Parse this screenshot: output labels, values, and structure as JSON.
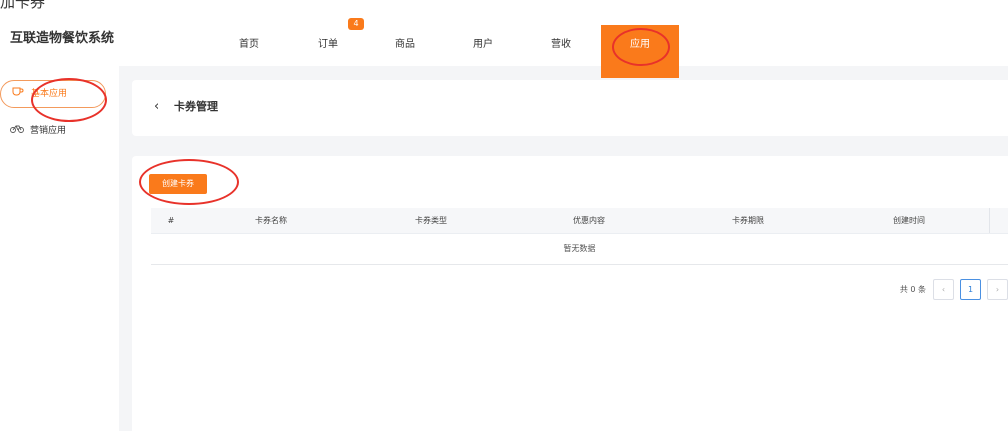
{
  "caption": {
    "text": "加卡券"
  },
  "header": {
    "brand": "互联造物餐饮系统",
    "nav": [
      {
        "label": "首页",
        "badge": ""
      },
      {
        "label": "订单",
        "badge": "4"
      },
      {
        "label": "商品",
        "badge": ""
      },
      {
        "label": "用户",
        "badge": ""
      },
      {
        "label": "营收",
        "badge": ""
      },
      {
        "label": "应用",
        "badge": "",
        "active": true
      }
    ]
  },
  "sidebar": {
    "items": [
      {
        "label": "基本应用",
        "icon": "cup-icon",
        "active": true
      },
      {
        "label": "营销应用",
        "icon": "bicycle-icon",
        "active": false
      }
    ]
  },
  "page": {
    "title": "卡券管理"
  },
  "toolbar": {
    "create_label": "创建卡券"
  },
  "table": {
    "columns": [
      "#",
      "卡券名称",
      "卡券类型",
      "优惠内容",
      "卡券期限",
      "创建时间"
    ],
    "rows": [],
    "empty_text": "暂无数据"
  },
  "pagination": {
    "total_text": "共 0 条",
    "current_page": "1",
    "prev_label": "‹",
    "next_label": "›"
  },
  "colors": {
    "accent": "#fa7a1b",
    "annotation": "#e8322a"
  }
}
